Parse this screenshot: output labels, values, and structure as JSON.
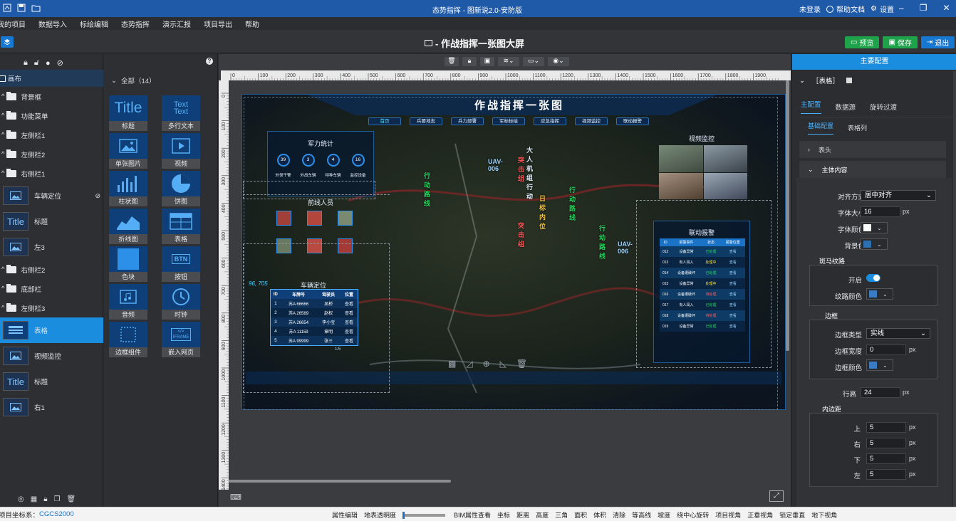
{
  "window": {
    "title": "态势指挥 - 图新说2.0-安防版",
    "login": "未登录",
    "help": "帮助文档",
    "settings": "设置"
  },
  "menu": [
    "我的项目",
    "数据导入",
    "标绘编辑",
    "态势指挥",
    "演示汇报",
    "项目导出",
    "帮助"
  ],
  "header": {
    "title": "- 作战指挥一张图大屏",
    "preview": "预览",
    "save": "保存",
    "exit": "退出"
  },
  "left": {
    "tree": [
      {
        "label": "画布",
        "kind": "root"
      },
      {
        "label": "背景框",
        "kind": "folder"
      },
      {
        "label": "功能菜单",
        "kind": "folder"
      },
      {
        "label": "左侧栏1",
        "kind": "folder"
      },
      {
        "label": "左侧栏2",
        "kind": "folder"
      },
      {
        "label": "右侧栏1",
        "kind": "folder"
      }
    ],
    "layers1": [
      {
        "label": "车辆定位",
        "thumb": "image"
      },
      {
        "label": "标题",
        "thumb": "title"
      },
      {
        "label": "左3",
        "thumb": "image"
      }
    ],
    "tree2": [
      {
        "label": "右侧栏2"
      },
      {
        "label": "底部栏"
      },
      {
        "label": "左侧栏3"
      }
    ],
    "layers2": [
      {
        "label": "表格",
        "thumb": "table",
        "selected": true
      },
      {
        "label": "视频监控",
        "thumb": "image"
      },
      {
        "label": "标题",
        "thumb": "title"
      },
      {
        "label": "右1",
        "thumb": "image"
      }
    ]
  },
  "components": {
    "header": "全部（14）",
    "items": [
      "标题",
      "多行文本",
      "单张图片",
      "视频",
      "柱状图",
      "饼图",
      "折线图",
      "表格",
      "色块",
      "按钮",
      "音频",
      "时钟",
      "边框组件",
      "嵌入网页"
    ],
    "title_glyph": "Title",
    "text_glyph": "Text",
    "btn_glyph": "BTN",
    "iframe_glyph": "IFRAME"
  },
  "ruler": {
    "top": [
      "0",
      "100",
      "200",
      "300",
      "400",
      "500",
      "600",
      "700",
      "800",
      "900",
      "1000",
      "1100",
      "1200",
      "1300",
      "1400",
      "1500",
      "1600",
      "1700",
      "1800",
      "1900"
    ],
    "left": [
      "0",
      "100",
      "200",
      "300",
      "400",
      "500",
      "600",
      "700",
      "800",
      "900",
      "1000",
      "1100",
      "1200",
      "1300",
      "1400"
    ]
  },
  "screen": {
    "title": "作战指挥一张图",
    "nav": [
      "首页",
      "兵要地志",
      "兵力部署",
      "军标标绘",
      "应急指挥",
      "视频监控",
      "联动报警"
    ],
    "force": {
      "title": "军力统计",
      "items": [
        {
          "value": "39",
          "label": "外领干警"
        },
        {
          "value": "3",
          "label": "外战车辆"
        },
        {
          "value": "4",
          "label": "特种车辆"
        },
        {
          "value": "16",
          "label": "监控设备"
        }
      ]
    },
    "personnel": {
      "title": "前线人员"
    },
    "vehicle": {
      "title": "车辆定位",
      "cols": [
        "ID",
        "车牌号",
        "驾驶员",
        "位置"
      ],
      "rows": [
        [
          "1",
          "苏A 66666",
          "吴桥",
          "查看"
        ],
        [
          "2",
          "苏A 26589",
          "赵权",
          "查看"
        ],
        [
          "3",
          "苏A 26654",
          "李小宝",
          "查看"
        ],
        [
          "4",
          "苏A 11159",
          "章明",
          "查看"
        ],
        [
          "5",
          "苏A 99999",
          "张三",
          "查看"
        ]
      ],
      "pager": "1/5"
    },
    "coord": "96, 705",
    "video": {
      "title": "视频监控"
    },
    "alarm": {
      "title": "联动报警",
      "cols": [
        "ID",
        "报警事件",
        "状态",
        "报警位置"
      ],
      "rows": [
        [
          "012",
          "设备异常",
          "已处理",
          "查看"
        ],
        [
          "013",
          "有人闯入",
          "处理中",
          "查看"
        ],
        [
          "014",
          "设备遭破坏",
          "已处理",
          "查看"
        ],
        [
          "015",
          "设备异常",
          "处理中",
          "查看"
        ],
        [
          "016",
          "设备遭破坏",
          "待处理",
          "查看"
        ],
        [
          "017",
          "有人闯入",
          "已处理",
          "查看"
        ],
        [
          "018",
          "设备遭破坏",
          "待处理",
          "查看"
        ],
        [
          "019",
          "设备异常",
          "已处理",
          "查看"
        ]
      ]
    },
    "map_labels": [
      "行动路线",
      "突击组",
      "行动路线",
      "日标内位",
      "突击组",
      "行动路线",
      "UAV-006",
      "大人机组行动",
      "UAV-006"
    ]
  },
  "right": {
    "tab": "主要配置",
    "section": "［表格］",
    "subtabs": [
      "主配置",
      "数据源",
      "旋转过渡"
    ],
    "subtabs2": [
      "基础配置",
      "表格列"
    ],
    "groups": {
      "header": "表头",
      "body": "主体内容"
    },
    "align": {
      "label": "对齐方式",
      "value": "居中对齐"
    },
    "font_size": {
      "label": "字体大小",
      "value": "16",
      "unit": "px"
    },
    "font_color": {
      "label": "字体颜色",
      "color": "#ffffff"
    },
    "bg_color": {
      "label": "背景色",
      "color": "#2e6fb0"
    },
    "stripe": {
      "title": "斑马纹路",
      "enable_label": "开启",
      "enabled": true,
      "color_label": "纹路颜色",
      "color": "#3a7cc3"
    },
    "border": {
      "title": "边框",
      "type_label": "边框类型",
      "type_value": "实线",
      "width_label": "边框宽度",
      "width_value": "0",
      "unit": "px",
      "color_label": "边框颜色",
      "color": "#3a7cc3"
    },
    "line_height": {
      "label": "行高",
      "value": "24",
      "unit": "px"
    },
    "padding": {
      "title": "内边距",
      "top_label": "上",
      "top": "5",
      "right_label": "右",
      "right": "5",
      "bottom_label": "下",
      "bottom": "5",
      "left_label": "左",
      "left": "5",
      "unit": "px"
    }
  },
  "status": {
    "coord_label": "项目坐标系：",
    "coord_value": "CGCS2000",
    "items": [
      "属性编辑",
      "地表透明度",
      "BIM属性查看",
      "坐标",
      "距离",
      "高度",
      "三角",
      "面积",
      "体积",
      "清除",
      "等高线",
      "坡度",
      "绕中心旋转",
      "项目视角",
      "正垂视角",
      "锁定垂直",
      "地下视角"
    ]
  }
}
